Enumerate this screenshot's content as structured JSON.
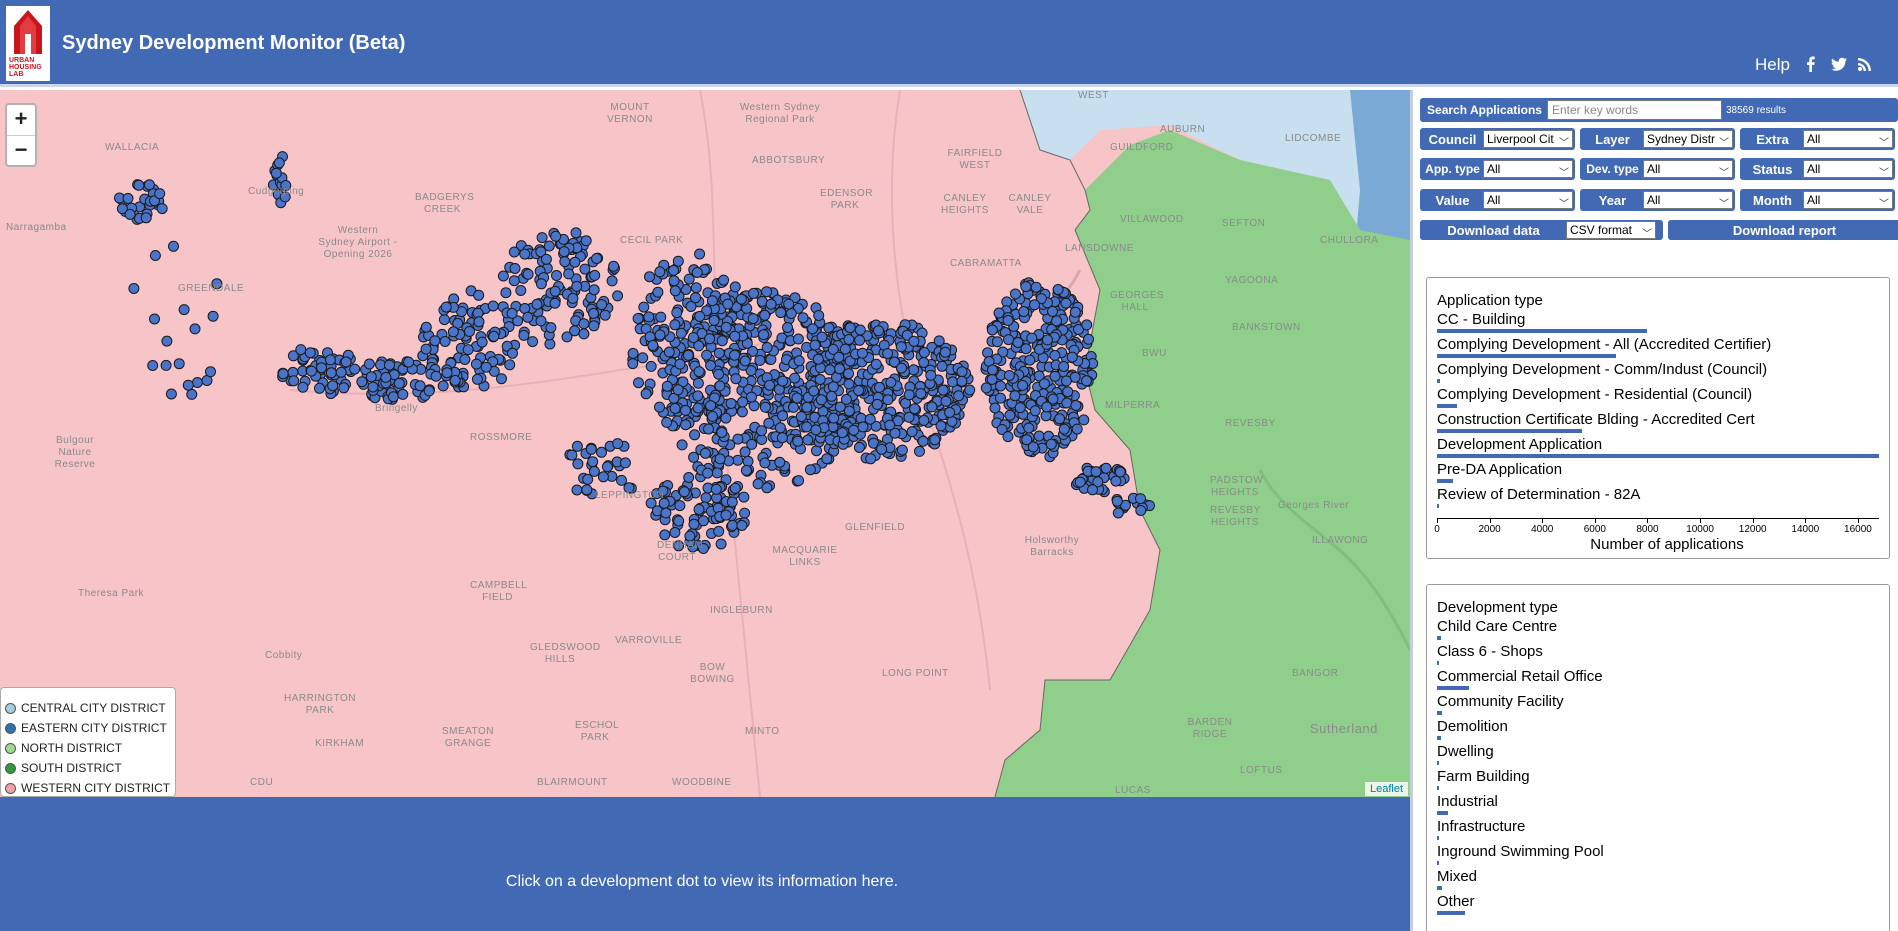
{
  "header": {
    "title": "Sydney Development Monitor (Beta)",
    "logo_text": "URBAN HOUSING LAB",
    "help_label": "Help",
    "icons": [
      "facebook-icon",
      "twitter-icon",
      "rss-icon"
    ]
  },
  "map": {
    "zoom_in": "+",
    "zoom_out": "−",
    "attribution": "Leaflet",
    "legend": [
      {
        "label": "CENTRAL CITY DISTRICT",
        "color": "#a6cce0"
      },
      {
        "label": "EASTERN CITY DISTRICT",
        "color": "#2f6fb3"
      },
      {
        "label": "NORTH DISTRICT",
        "color": "#9fd88f"
      },
      {
        "label": "SOUTH DISTRICT",
        "color": "#2e9a3a"
      },
      {
        "label": "WESTERN CITY DISTRICT",
        "color": "#f2a3a8"
      }
    ],
    "colors": {
      "western": "#f7c4c8",
      "south": "#8fcf8b",
      "central": "#c8dff0",
      "eastern": "#7aa9d6",
      "dots": "#4a74c9"
    },
    "places": [
      "WALLACIA",
      "MOUNT VERNON",
      "Western Sydney Regional Park",
      "ABBOTSBURY",
      "EDENSOR PARK",
      "FAIRFIELD WEST",
      "BADGERYS CREEK",
      "Western Sydney Airport - Opening 2026",
      "CECIL PARK",
      "CANLEY HEIGHTS",
      "CANLEY VALE",
      "CABRAMATTA",
      "VILLAWOOD",
      "SEFTON",
      "CHULLORA",
      "LANSDOWNE",
      "YAGOONA",
      "GREENDALE",
      "GEORGES HALL",
      "BANKSTOWN",
      "BWU",
      "Bulgour Nature Reserve",
      "ROSSMORE",
      "MILPERRA",
      "REVESBY",
      "LEPPINGTON",
      "GLENFIELD",
      "Holsworthy Barracks",
      "PADSTOW HEIGHTS",
      "REVESBY HEIGHTS",
      "Georges River",
      "ILLAWONG",
      "DENHAM COURT",
      "MACQUARIE LINKS",
      "Theresa Park",
      "CAMPBELL FIELD",
      "INGLEBURN",
      "Cobbity",
      "GLEDSWOOD HILLS",
      "VARROVILLE",
      "BOW BOWING",
      "LONG POINT",
      "BANGOR",
      "HARRINGTON PARK",
      "SMEATON GRANGE",
      "ESCHOL PARK",
      "MINTO",
      "BARDEN RIDGE",
      "Sutherland",
      "KIRKHAM",
      "CDU",
      "BLAIRMOUNT",
      "WOODBINE",
      "LUCAS",
      "LOFTUS",
      "AUBURN",
      "LIDCOMBE",
      "GUILDFORD",
      "WEST",
      "Cudgegong",
      "Narragamba",
      "Bringelly"
    ],
    "info_prompt": "Click on a development dot to view its information here."
  },
  "panel": {
    "search": {
      "label": "Search Applications",
      "placeholder": "Enter key words",
      "results": "38569 results"
    },
    "filters": {
      "council": {
        "label": "Council",
        "value": "Liverpool Cit"
      },
      "layer": {
        "label": "Layer",
        "value": "Sydney Distr"
      },
      "extra": {
        "label": "Extra",
        "value": "All"
      },
      "app_type": {
        "label": "App. type",
        "value": "All"
      },
      "dev_type": {
        "label": "Dev. type",
        "value": "All"
      },
      "status": {
        "label": "Status",
        "value": "All"
      },
      "value": {
        "label": "Value",
        "value": "All"
      },
      "year": {
        "label": "Year",
        "value": "All"
      },
      "month": {
        "label": "Month",
        "value": "All"
      }
    },
    "download": {
      "data_label": "Download data",
      "format": "CSV format",
      "report_label": "Download report"
    }
  },
  "chart_data": [
    {
      "type": "bar",
      "title": "Application type",
      "xlabel": "Number of applications",
      "xlim": [
        0,
        16800
      ],
      "ticks": [
        "0",
        "2000",
        "4000",
        "6000",
        "8000",
        "10000",
        "12000",
        "14000",
        "16000"
      ],
      "categories": [
        "CC - Building",
        "Complying Development - All (Accredited Certifier)",
        "Complying Development - Comm/Indust (Council)",
        "Complying Development - Residential (Council)",
        "Construction Certificate Blding - Accredited Cert",
        "Development Application",
        "Pre-DA Application",
        "Review of Determination - 82A"
      ],
      "values": [
        8000,
        6800,
        120,
        750,
        5500,
        16800,
        600,
        40
      ]
    },
    {
      "type": "bar",
      "title": "Development type",
      "categories": [
        "Child Care Centre",
        "Class 6 - Shops",
        "Commercial Retail Office",
        "Community Facility",
        "Demolition",
        "Dwelling",
        "Farm Building",
        "Industrial",
        "Infrastructure",
        "Inground Swimming Pool",
        "Mixed",
        "Other"
      ],
      "values": [
        150,
        60,
        1200,
        200,
        150,
        80,
        40,
        400,
        60,
        80,
        200,
        1050
      ]
    }
  ]
}
